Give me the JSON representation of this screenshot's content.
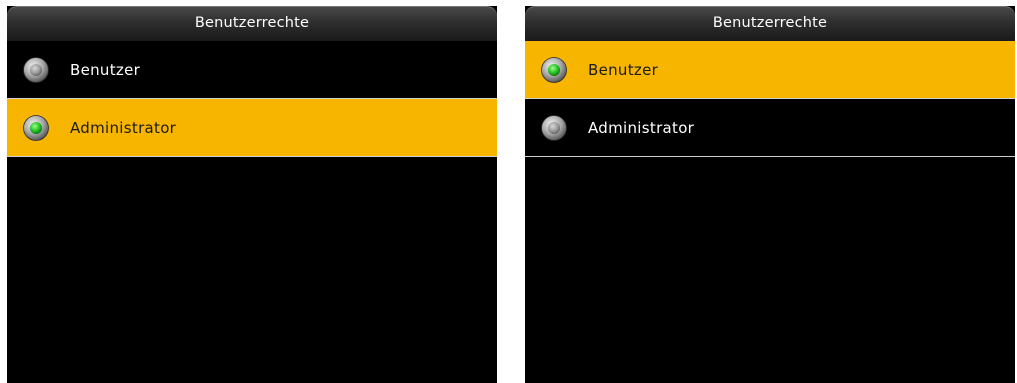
{
  "screens": [
    {
      "title": "Benutzerrechte",
      "options": [
        {
          "label": "Benutzer",
          "checked": false,
          "highlighted": false,
          "icon": "radio-unchecked-icon"
        },
        {
          "label": "Administrator",
          "checked": true,
          "highlighted": true,
          "icon": "radio-checked-icon"
        }
      ]
    },
    {
      "title": "Benutzerrechte",
      "options": [
        {
          "label": "Benutzer",
          "checked": true,
          "highlighted": true,
          "icon": "radio-checked-icon"
        },
        {
          "label": "Administrator",
          "checked": false,
          "highlighted": false,
          "icon": "radio-unchecked-icon"
        }
      ]
    }
  ],
  "colors": {
    "highlight": "#f7b500",
    "background": "#000000",
    "radio_on": "#22c022",
    "radio_off": "#9a9a9a"
  }
}
